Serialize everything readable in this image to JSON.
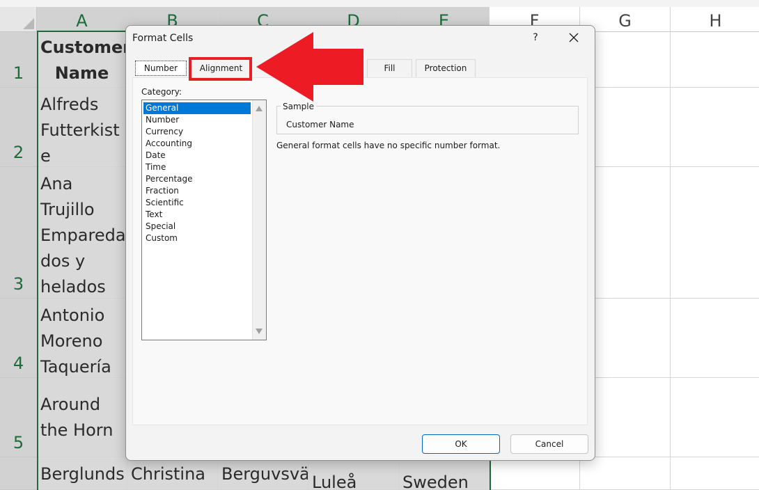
{
  "spreadsheet": {
    "columns": [
      "A",
      "B",
      "C",
      "D",
      "E",
      "F",
      "G",
      "H"
    ],
    "rows": [
      "1",
      "2",
      "3",
      "4",
      "5"
    ],
    "cells": {
      "a1": "Customer\nName",
      "a2": "Alfreds\nFutterkist\ne",
      "a3": "Ana\nTrujillo\nEmpareda\ndos y\nhelados",
      "a4": "Antonio\nMoreno\nTaquería",
      "a5": "Around\nthe Horn",
      "a6": "Berglunds",
      "b6": "Christina",
      "c6": "Berguvsvä",
      "d6": "Luleå",
      "e6": "Sweden"
    }
  },
  "dialog": {
    "title": "Format Cells",
    "help_label": "?",
    "tabs": {
      "number": "Number",
      "alignment": "Alignment",
      "fill": "Fill",
      "protection": "Protection"
    },
    "category_label": "Category:",
    "categories": [
      "General",
      "Number",
      "Currency",
      "Accounting",
      "Date",
      "Time",
      "Percentage",
      "Fraction",
      "Scientific",
      "Text",
      "Special",
      "Custom"
    ],
    "selected_category": "General",
    "sample": {
      "label": "Sample",
      "value": "Customer Name"
    },
    "description": "General format cells have no specific number format.",
    "ok_label": "OK",
    "cancel_label": "Cancel"
  },
  "annotation": {
    "highlight_color": "#e81e25",
    "arrow_icon": "red-arrow-left"
  },
  "colors": {
    "excel_green": "#1d6b3b",
    "selection_blue": "#0078d7"
  }
}
